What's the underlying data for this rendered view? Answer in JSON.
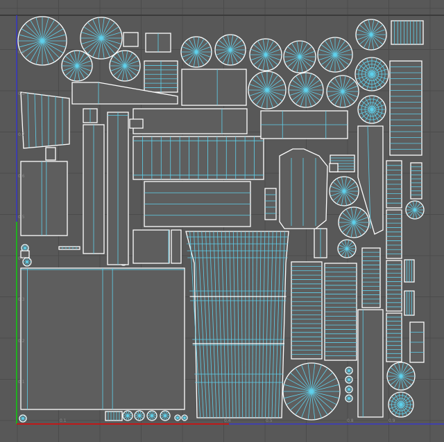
{
  "viewport": {
    "name": "UV Editor",
    "colors": {
      "background": "#585858",
      "grid": "#4b4b4b",
      "frame": "#3a3a3a",
      "shell_outline": "#ffffff",
      "shell_fill": "#5e5e5e",
      "edges": "#5fd1ec",
      "axis_u": "#c01818",
      "axis_v": "#20b020",
      "border": "#3838c8"
    }
  },
  "axis_labels": {
    "v": [
      "0.9",
      "0.8",
      "0.7",
      "0.6",
      "0.5",
      "0.4",
      "0.3",
      "0.2",
      "0.1"
    ],
    "u": [
      "0.1",
      "0.4",
      "0.5",
      "0.8",
      "0.9"
    ]
  }
}
